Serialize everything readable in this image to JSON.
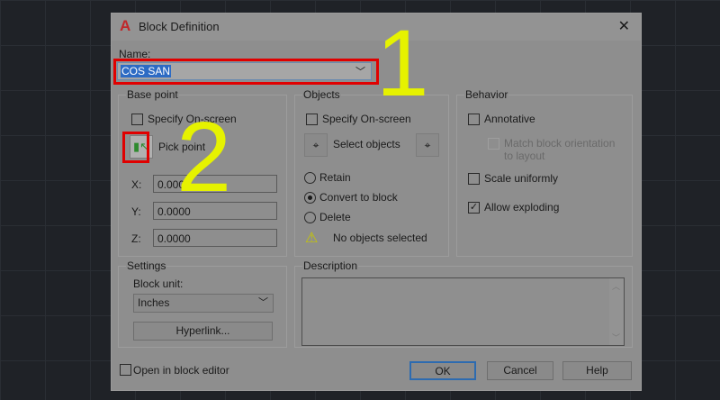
{
  "dialog": {
    "title": "Block Definition",
    "close": "✕"
  },
  "name": {
    "label": "Name:",
    "value": "COS SAN"
  },
  "base_point": {
    "label": "Base point",
    "specify": "Specify On-screen",
    "pick": "Pick point",
    "x_label": "X:",
    "y_label": "Y:",
    "z_label": "Z:",
    "x": "0.0000",
    "y": "0.0000",
    "z": "0.0000"
  },
  "objects": {
    "label": "Objects",
    "specify": "Specify On-screen",
    "select": "Select objects",
    "retain": "Retain",
    "convert": "Convert to block",
    "delete": "Delete",
    "status": "No objects selected",
    "selected_mode": "Convert to block"
  },
  "behavior": {
    "label": "Behavior",
    "annotative": "Annotative",
    "match": "Match block orientation",
    "match2": "to layout",
    "scale": "Scale uniformly",
    "explode": "Allow exploding",
    "explode_checked": true
  },
  "settings": {
    "label": "Settings",
    "unit_label": "Block unit:",
    "unit": "Inches",
    "hyperlink": "Hyperlink..."
  },
  "description": {
    "label": "Description",
    "value": ""
  },
  "footer": {
    "open_editor": "Open in block editor",
    "ok": "OK",
    "cancel": "Cancel",
    "help": "Help"
  },
  "annotations": {
    "step1": "1",
    "step2": "2",
    "highlight_color": "#e00000",
    "number_color": "#e6f200"
  }
}
